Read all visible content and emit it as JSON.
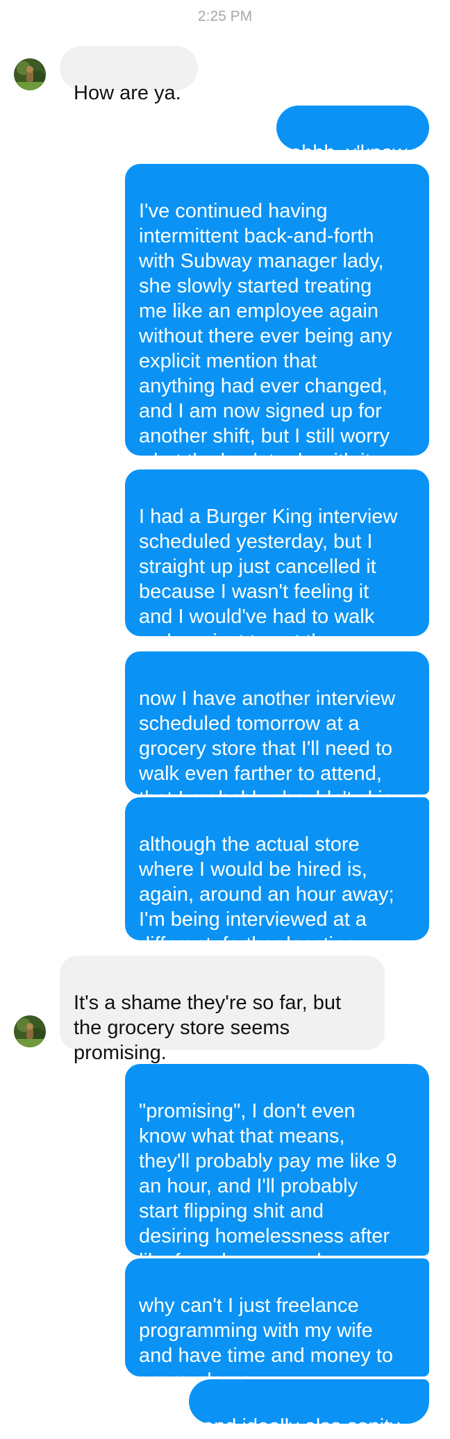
{
  "conversation": {
    "timestamp": "2:25 PM",
    "messages": [
      {
        "sender": "contact",
        "text": "How are ya."
      },
      {
        "sender": "me",
        "text": "ohhh, y'know"
      },
      {
        "sender": "me",
        "text": "I've continued having\nintermittent back-and-forth\nwith Subway manager lady,\nshe slowly started treating\nme like an employee again\nwithout there ever being any\nexplicit mention that\nanything had ever changed,\nand I am now signed up for\nanother shift, but I still worry\nwhat the heck to do with it"
      },
      {
        "sender": "me",
        "text": "I had a Burger King interview\nscheduled yesterday, but I\nstraight up just cancelled it\nbecause I wasn't feeling it\nand I would've had to walk\nan hour just to get there"
      },
      {
        "sender": "me",
        "text": "now I have another interview\nscheduled tomorrow at a\ngrocery store that I'll need to\nwalk even farther to attend,\nthat I probably shouldn't skip"
      },
      {
        "sender": "me",
        "text": "although the actual store\nwhere I would be hired is,\nagain, around an hour away;\nI'm being interviewed at a\ndifferent, farther location"
      },
      {
        "sender": "contact",
        "text": "It's a shame they're so far, but\nthe grocery store seems\npromising."
      },
      {
        "sender": "me",
        "text": "\"promising\", I don't even\nknow what that means,\nthey'll probably pay me like 9\nan hour, and I'll probably\nstart flipping shit and\ndesiring homelessness after\nlike four days a week"
      },
      {
        "sender": "me",
        "text": "why can't I just freelance\nprogramming with my wife\nand have time and money to\nspare, damn"
      },
      {
        "sender": "me",
        "text": "and ideally also sanity"
      }
    ]
  },
  "theme": {
    "outgoing_bubble": "#0a93f5",
    "incoming_bubble": "#f1f1f1",
    "timestamp_color": "#a7a7a7"
  },
  "icons": {
    "avatar": "contact-avatar-photo"
  }
}
